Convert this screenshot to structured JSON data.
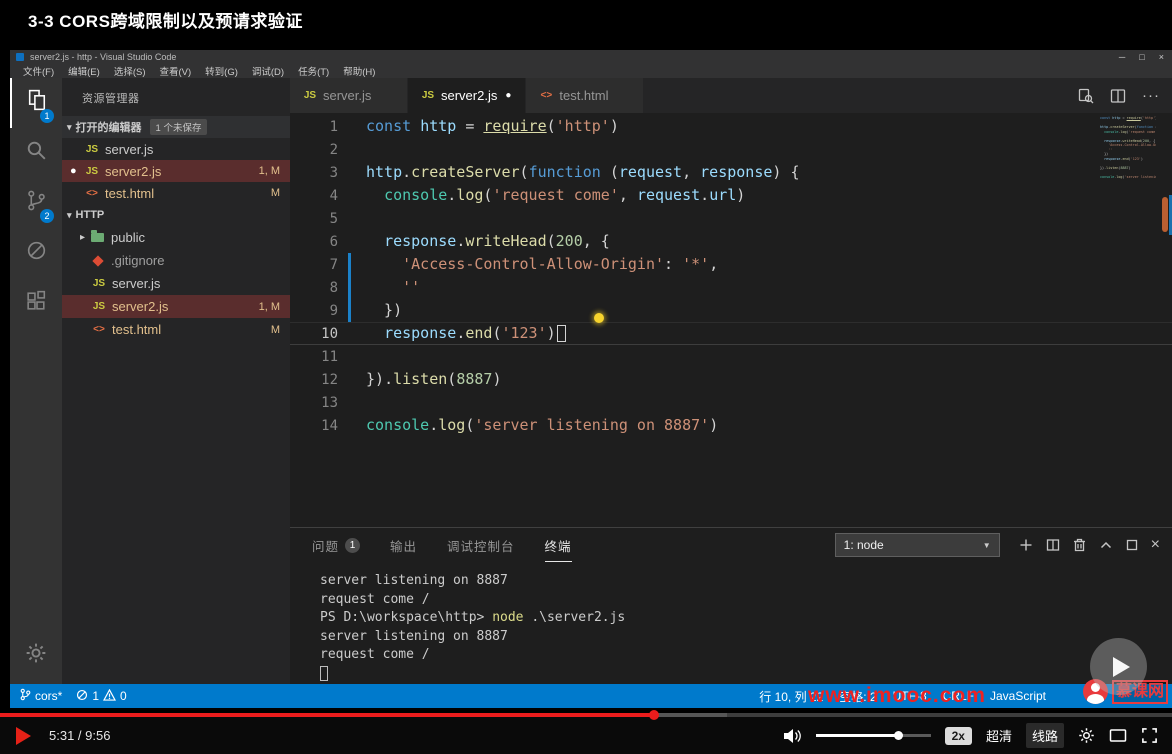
{
  "lesson_title": "3-3 CORS跨域限制以及预请求验证",
  "colors": {
    "statusbar": "#007acc",
    "accent_red": "#eb1c1c",
    "selection_red": "#5a2d2d"
  },
  "vscode": {
    "window_title": "server2.js - http - Visual Studio Code",
    "menubar": [
      "文件(F)",
      "编辑(E)",
      "选择(S)",
      "查看(V)",
      "转到(G)",
      "调试(D)",
      "任务(T)",
      "帮助(H)"
    ],
    "activity": {
      "explorer_badge": "1",
      "scm_badge": "2"
    },
    "sidebar": {
      "title": "资源管理器",
      "open_editors_label": "打开的编辑器",
      "open_editors_badge": "1 个未保存",
      "open_editors": [
        {
          "name": "server.js",
          "type": "js",
          "badge": "",
          "dirty": false,
          "selected": false
        },
        {
          "name": "server2.js",
          "type": "js",
          "badge": "1, M",
          "dirty": true,
          "selected": true
        },
        {
          "name": "test.html",
          "type": "html",
          "badge": "M",
          "dirty": false,
          "selected": false
        }
      ],
      "folder_label": "HTTP",
      "files": [
        {
          "name": "public",
          "type": "folder",
          "badge": "",
          "selected": false
        },
        {
          "name": ".gitignore",
          "type": "git",
          "badge": "",
          "selected": false
        },
        {
          "name": "server.js",
          "type": "js",
          "badge": "",
          "selected": false
        },
        {
          "name": "server2.js",
          "type": "js",
          "badge": "1, M",
          "selected": true
        },
        {
          "name": "test.html",
          "type": "html",
          "badge": "M",
          "selected": false
        }
      ]
    },
    "tabs": [
      {
        "label": "server.js",
        "type": "js",
        "active": false,
        "dirty": false
      },
      {
        "label": "server2.js",
        "type": "js",
        "active": true,
        "dirty": true
      },
      {
        "label": "test.html",
        "type": "html",
        "active": false,
        "dirty": false
      }
    ],
    "editor": {
      "cursor_line": 10,
      "lines": [
        {
          "tokens": [
            {
              "t": "const ",
              "c": "kw"
            },
            {
              "t": "http",
              "c": "var"
            },
            {
              "t": " = ",
              "c": "def"
            },
            {
              "t": "require",
              "c": "fn u"
            },
            {
              "t": "(",
              "c": "def"
            },
            {
              "t": "'http'",
              "c": "str"
            },
            {
              "t": ")",
              "c": "def"
            }
          ]
        },
        {
          "tokens": []
        },
        {
          "tokens": [
            {
              "t": "http",
              "c": "var"
            },
            {
              "t": ".",
              "c": "def"
            },
            {
              "t": "createServer",
              "c": "fn"
            },
            {
              "t": "(",
              "c": "def"
            },
            {
              "t": "function",
              "c": "kw"
            },
            {
              "t": " (",
              "c": "def"
            },
            {
              "t": "request",
              "c": "var"
            },
            {
              "t": ", ",
              "c": "def"
            },
            {
              "t": "response",
              "c": "var"
            },
            {
              "t": ") {",
              "c": "def"
            }
          ]
        },
        {
          "tokens": [
            {
              "t": "  ",
              "c": "def"
            },
            {
              "t": "console",
              "c": "cls"
            },
            {
              "t": ".",
              "c": "def"
            },
            {
              "t": "log",
              "c": "fn"
            },
            {
              "t": "(",
              "c": "def"
            },
            {
              "t": "'request come'",
              "c": "str"
            },
            {
              "t": ", ",
              "c": "def"
            },
            {
              "t": "request",
              "c": "var"
            },
            {
              "t": ".",
              "c": "def"
            },
            {
              "t": "url",
              "c": "var"
            },
            {
              "t": ")",
              "c": "def"
            }
          ]
        },
        {
          "tokens": []
        },
        {
          "tokens": [
            {
              "t": "  ",
              "c": "def"
            },
            {
              "t": "response",
              "c": "var"
            },
            {
              "t": ".",
              "c": "def"
            },
            {
              "t": "writeHead",
              "c": "fn"
            },
            {
              "t": "(",
              "c": "def"
            },
            {
              "t": "200",
              "c": "num"
            },
            {
              "t": ", {",
              "c": "def"
            }
          ]
        },
        {
          "tokens": [
            {
              "t": "    ",
              "c": "def"
            },
            {
              "t": "'Access-Control-Allow-Origin'",
              "c": "str"
            },
            {
              "t": ": ",
              "c": "def"
            },
            {
              "t": "'*'",
              "c": "str"
            },
            {
              "t": ",",
              "c": "def"
            }
          ]
        },
        {
          "tokens": [
            {
              "t": "    ",
              "c": "def"
            },
            {
              "t": "''",
              "c": "str"
            }
          ]
        },
        {
          "tokens": [
            {
              "t": "  })",
              "c": "def"
            }
          ]
        },
        {
          "tokens": [
            {
              "t": "  ",
              "c": "def"
            },
            {
              "t": "response",
              "c": "var"
            },
            {
              "t": ".",
              "c": "def"
            },
            {
              "t": "end",
              "c": "fn"
            },
            {
              "t": "(",
              "c": "def"
            },
            {
              "t": "'123'",
              "c": "str"
            },
            {
              "t": ")",
              "c": "def"
            }
          ]
        },
        {
          "tokens": []
        },
        {
          "tokens": [
            {
              "t": "})",
              "c": "def"
            },
            {
              "t": ".",
              "c": "def"
            },
            {
              "t": "listen",
              "c": "fn"
            },
            {
              "t": "(",
              "c": "def"
            },
            {
              "t": "8887",
              "c": "num"
            },
            {
              "t": ")",
              "c": "def"
            }
          ]
        },
        {
          "tokens": []
        },
        {
          "tokens": [
            {
              "t": "console",
              "c": "cls"
            },
            {
              "t": ".",
              "c": "def"
            },
            {
              "t": "log",
              "c": "fn"
            },
            {
              "t": "(",
              "c": "def"
            },
            {
              "t": "'server listening on 8887'",
              "c": "str"
            },
            {
              "t": ")",
              "c": "def"
            }
          ]
        }
      ]
    },
    "panel": {
      "tabs": [
        {
          "label": "问题",
          "badge": "1",
          "active": false
        },
        {
          "label": "输出",
          "badge": "",
          "active": false
        },
        {
          "label": "调试控制台",
          "badge": "",
          "active": false
        },
        {
          "label": "终端",
          "badge": "",
          "active": true
        }
      ],
      "terminal_select": "1: node",
      "terminal": [
        [
          {
            "t": "server listening on 8887",
            "c": "tdef"
          }
        ],
        [
          {
            "t": "request come /",
            "c": "tdef"
          }
        ],
        [
          {
            "t": "PS D:\\workspace\\http> ",
            "c": "tdef"
          },
          {
            "t": "node",
            "c": "tcmd"
          },
          {
            "t": " .\\server2.js",
            "c": "tdef"
          }
        ],
        [
          {
            "t": "server listening on 8887",
            "c": "tdef"
          }
        ],
        [
          {
            "t": "request come /",
            "c": "tdef"
          }
        ],
        []
      ]
    },
    "statusbar": {
      "branch": "cors*",
      "errors": "1",
      "warnings": "0",
      "items": [
        "行 10, 列 22",
        "空格: 2",
        "UTF-8",
        "CRLF",
        "JavaScript"
      ]
    }
  },
  "watermark": {
    "text": "www.imooc.com",
    "logo": "慕课网"
  },
  "player": {
    "time": "5:31 / 9:56",
    "speed": "2x",
    "quality": "超清",
    "route": "线路",
    "progress_pct": 55.8,
    "volume_pct": 72
  }
}
